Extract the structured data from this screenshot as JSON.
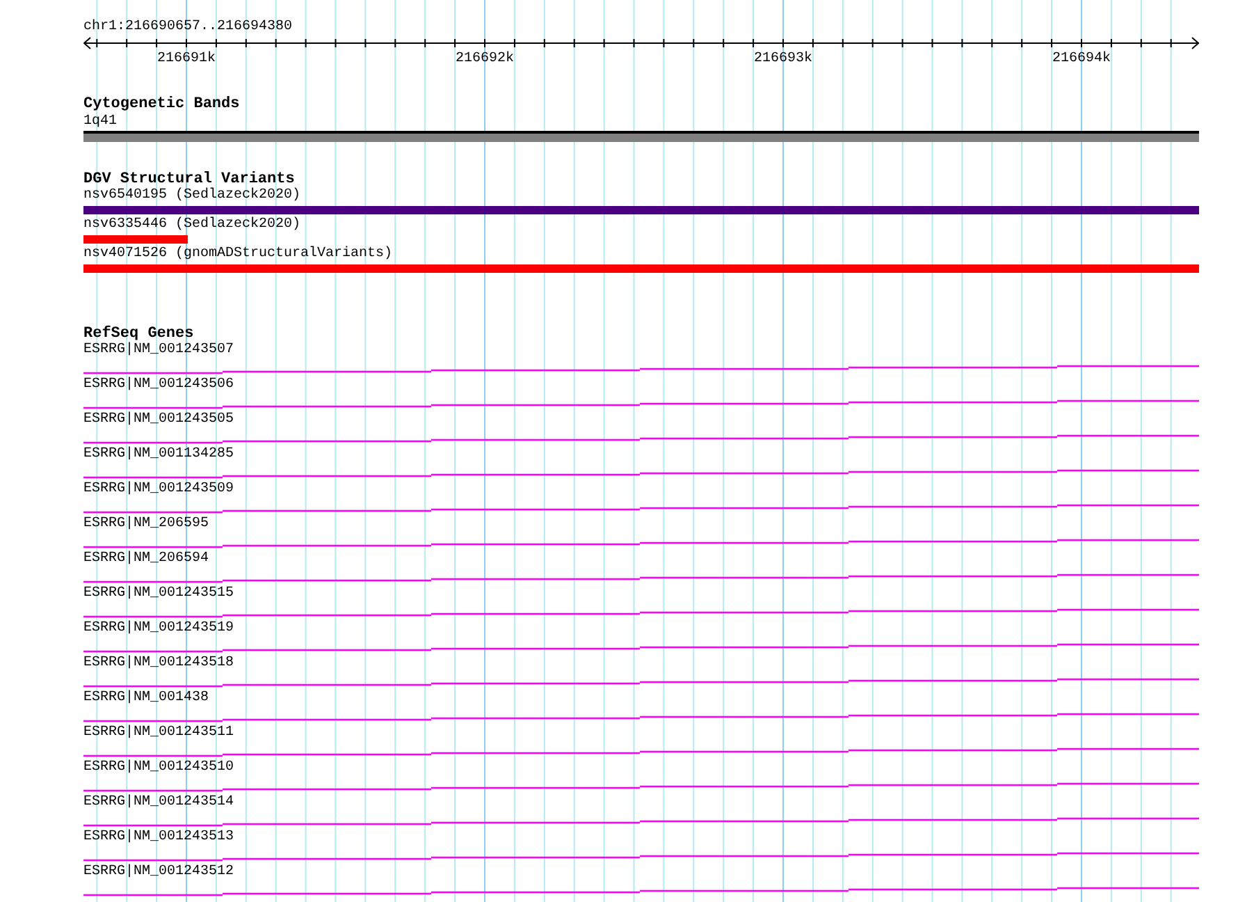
{
  "ruler": {
    "label": "chr1:216690657..216694380",
    "ticks": [
      "216691k",
      "216692k",
      "216693k",
      "216694k"
    ]
  },
  "cytoband_track": {
    "title": "Cytogenetic Bands",
    "band": "1q41"
  },
  "dgv_track": {
    "title": "DGV Structural Variants",
    "variants": [
      {
        "label": "nsv6540195 (Sedlazeck2020)",
        "color": "#4b0082",
        "kind": "full"
      },
      {
        "label": "nsv6335446 (Sedlazeck2020)",
        "color": "#ff0000",
        "kind": "partial"
      },
      {
        "label": "nsv4071526 (gnomADStructuralVariants)",
        "color": "#ff0000",
        "kind": "full"
      }
    ]
  },
  "refseq_track": {
    "title": "RefSeq Genes",
    "genes": [
      "ESRRG|NM_001243507",
      "ESRRG|NM_001243506",
      "ESRRG|NM_001243505",
      "ESRRG|NM_001134285",
      "ESRRG|NM_001243509",
      "ESRRG|NM_206595",
      "ESRRG|NM_206594",
      "ESRRG|NM_001243515",
      "ESRRG|NM_001243519",
      "ESRRG|NM_001243518",
      "ESRRG|NM_001438",
      "ESRRG|NM_001243511",
      "ESRRG|NM_001243510",
      "ESRRG|NM_001243514",
      "ESRRG|NM_001243513",
      "ESRRG|NM_001243512"
    ]
  }
}
